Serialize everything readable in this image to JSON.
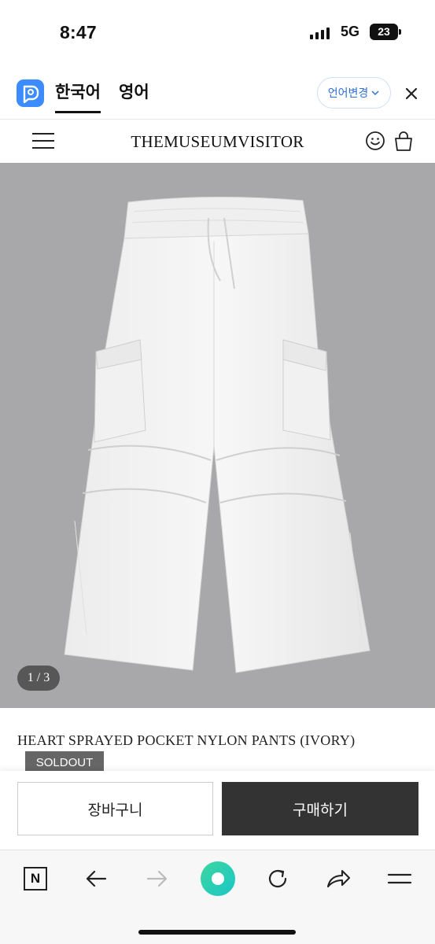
{
  "status_bar": {
    "time": "8:47",
    "network": "5G",
    "battery": "23"
  },
  "translate_bar": {
    "tab_korean": "한국어",
    "tab_english": "영어",
    "change_language": "언어변경",
    "accent_color": "#3c8cff"
  },
  "header": {
    "brand": "THEMUSEUMVISITOR"
  },
  "product": {
    "image_alt_icon": "cargo-pants-photo",
    "pager": "1 / 3",
    "name": "HEART SPRAYED POCKET NYLON PANTS (IVORY)",
    "badge": "SOLDOUT"
  },
  "actions": {
    "cart": "장바구니",
    "buy": "구매하기"
  },
  "browser_toolbar": {
    "icons": [
      "naver-n-icon",
      "back-arrow-icon",
      "forward-arrow-icon",
      "green-dot-icon",
      "reload-icon",
      "share-icon",
      "menu-icon"
    ]
  }
}
